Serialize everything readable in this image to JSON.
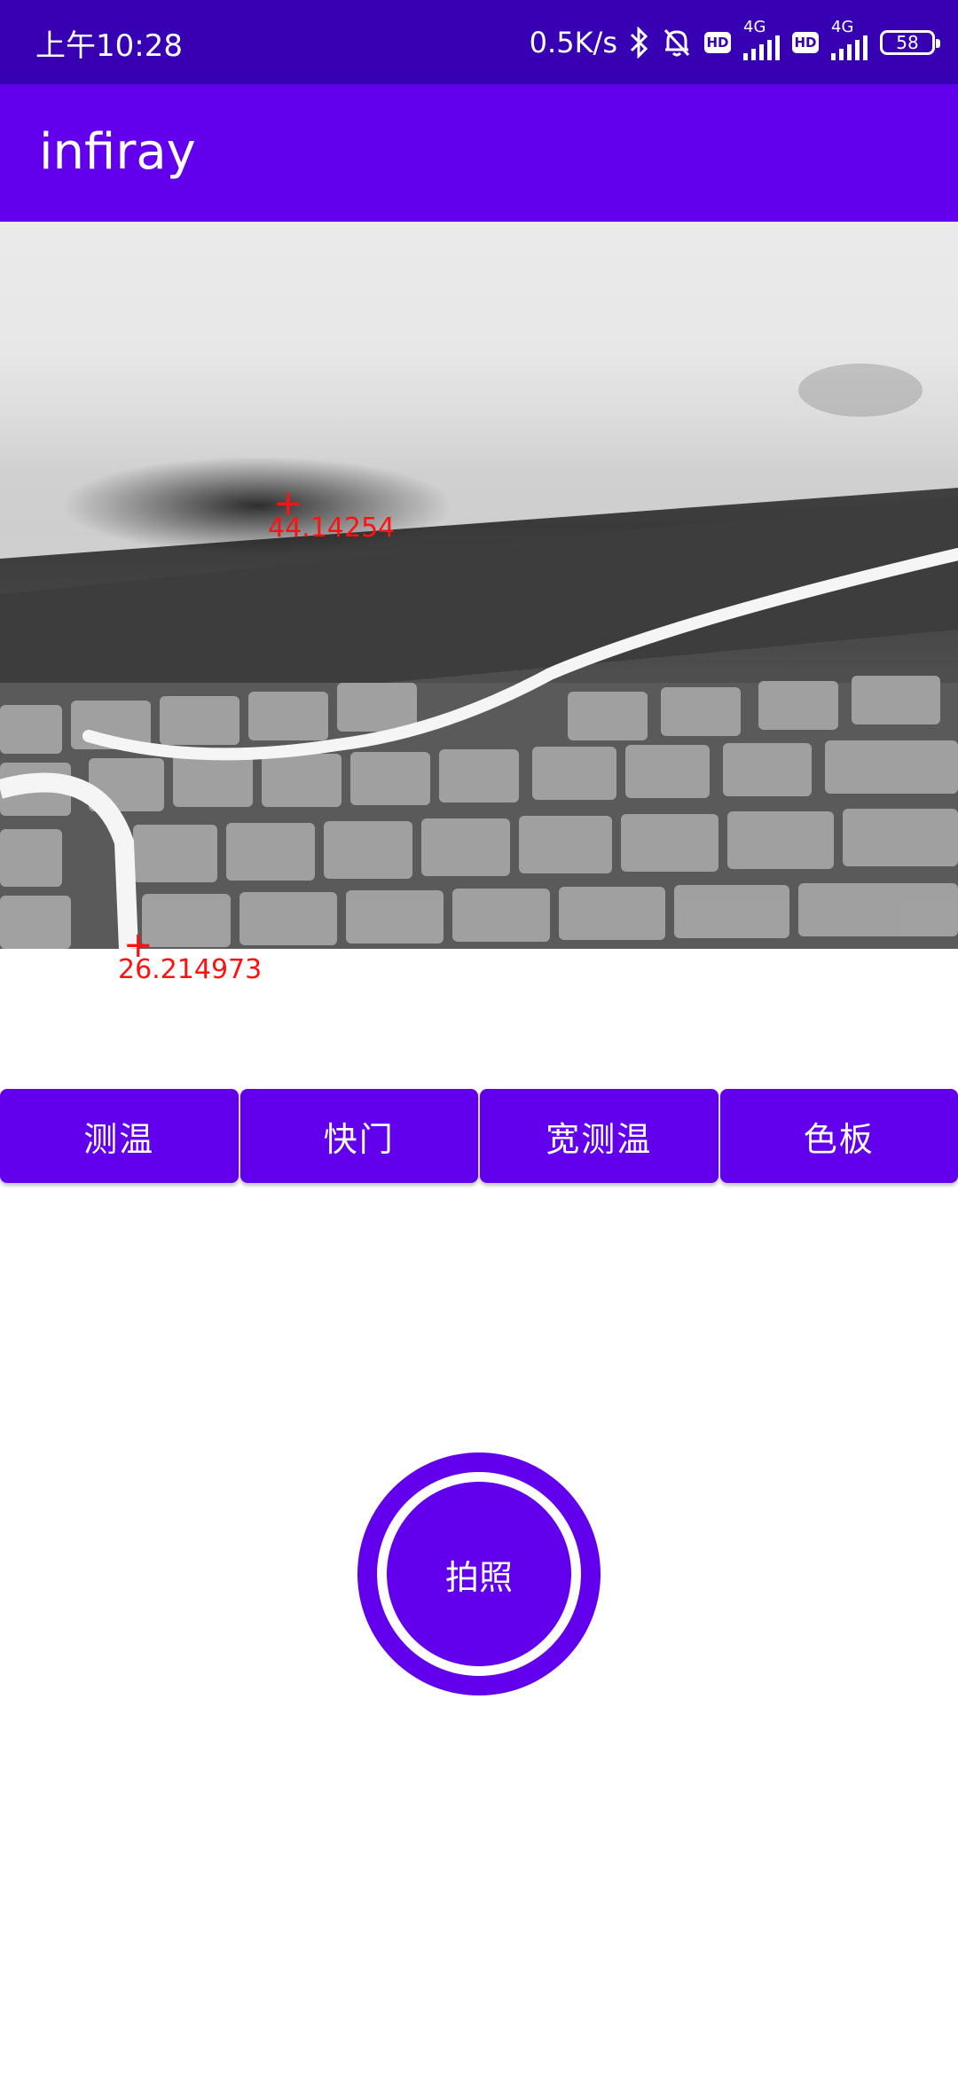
{
  "status_bar": {
    "time": "上午10:28",
    "net_speed": "0.5K/s",
    "bluetooth_icon": "bluetooth-icon",
    "mute_icon": "bell-off-icon",
    "hd_label": "HD",
    "network_type": "4G",
    "battery_level": "58"
  },
  "app_bar": {
    "title": "infiray"
  },
  "thermal_view": {
    "markers": [
      {
        "label": "44.14254",
        "symbol": "+"
      },
      {
        "label": "26.214973",
        "symbol": "+"
      }
    ]
  },
  "controls": {
    "buttons": [
      {
        "label": "测温"
      },
      {
        "label": "快门"
      },
      {
        "label": "宽测温"
      },
      {
        "label": "色板"
      }
    ],
    "capture_label": "拍照"
  },
  "colors": {
    "status_bar": "#3700B3",
    "primary": "#6200EE",
    "marker": "#ff1111"
  }
}
